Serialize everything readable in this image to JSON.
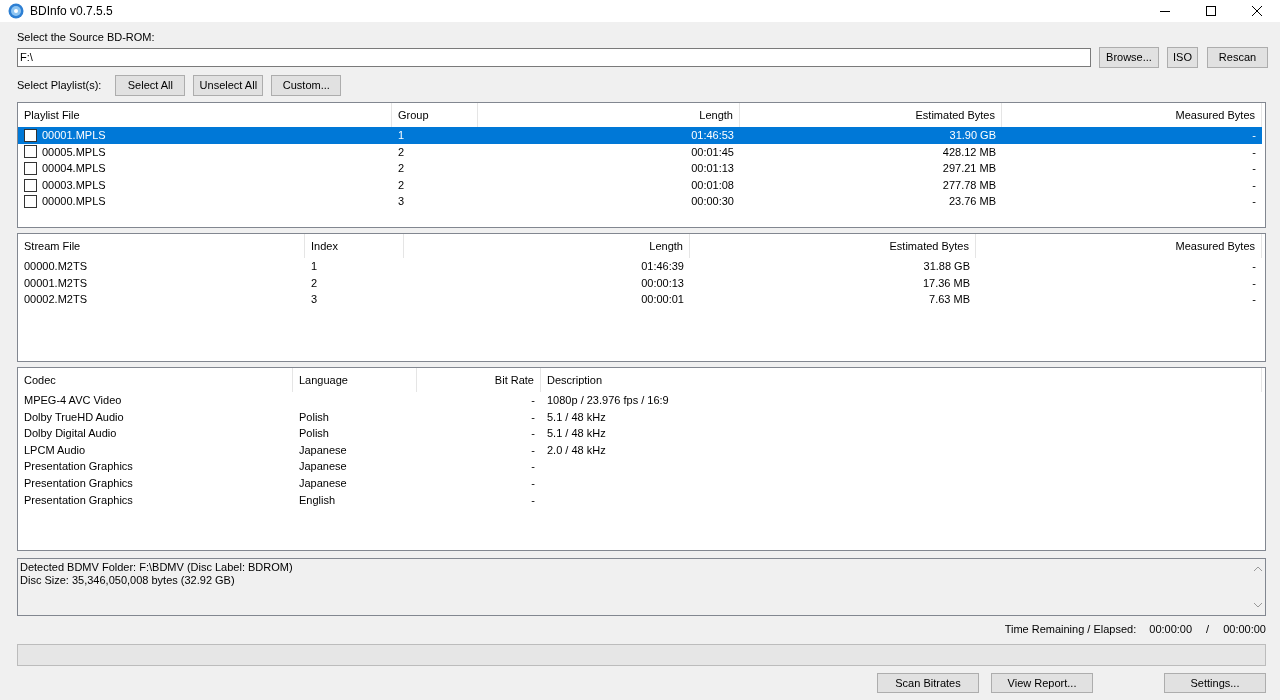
{
  "window": {
    "title": "BDInfo v0.7.5.5"
  },
  "source": {
    "label": "Select the Source BD-ROM:",
    "value": "F:\\",
    "buttons": [
      "Browse...",
      "ISO",
      "Rescan"
    ]
  },
  "playlist_select": {
    "label": "Select Playlist(s):",
    "buttons": [
      "Select All",
      "Unselect All",
      "Custom..."
    ]
  },
  "playlists": {
    "columns": [
      "Playlist File",
      "Group",
      "Length",
      "Estimated Bytes",
      "Measured Bytes"
    ],
    "rows": [
      {
        "checked": false,
        "selected": true,
        "cells": [
          "00001.MPLS",
          "1",
          "01:46:53",
          "31.90 GB",
          "-"
        ]
      },
      {
        "checked": false,
        "selected": false,
        "cells": [
          "00005.MPLS",
          "2",
          "00:01:45",
          "428.12 MB",
          "-"
        ]
      },
      {
        "checked": false,
        "selected": false,
        "cells": [
          "00004.MPLS",
          "2",
          "00:01:13",
          "297.21 MB",
          "-"
        ]
      },
      {
        "checked": false,
        "selected": false,
        "cells": [
          "00003.MPLS",
          "2",
          "00:01:08",
          "277.78 MB",
          "-"
        ]
      },
      {
        "checked": false,
        "selected": false,
        "cells": [
          "00000.MPLS",
          "3",
          "00:00:30",
          "23.76 MB",
          "-"
        ]
      }
    ]
  },
  "streams": {
    "columns": [
      "Stream File",
      "Index",
      "Length",
      "Estimated Bytes",
      "Measured Bytes"
    ],
    "rows": [
      [
        "00000.M2TS",
        "1",
        "01:46:39",
        "31.88 GB",
        "-"
      ],
      [
        "00001.M2TS",
        "2",
        "00:00:13",
        "17.36 MB",
        "-"
      ],
      [
        "00002.M2TS",
        "3",
        "00:00:01",
        "7.63 MB",
        "-"
      ]
    ]
  },
  "codecs": {
    "columns": [
      "Codec",
      "Language",
      "Bit Rate",
      "Description"
    ],
    "rows": [
      [
        "MPEG-4 AVC Video",
        "",
        "-",
        "1080p / 23.976 fps / 16:9"
      ],
      [
        "Dolby TrueHD Audio",
        "Polish",
        "-",
        "5.1 / 48 kHz"
      ],
      [
        "Dolby Digital Audio",
        "Polish",
        "-",
        "5.1 / 48 kHz"
      ],
      [
        "LPCM Audio",
        "Japanese",
        "-",
        "2.0 / 48 kHz"
      ],
      [
        "Presentation Graphics",
        "Japanese",
        "-",
        ""
      ],
      [
        "Presentation Graphics",
        "Japanese",
        "-",
        ""
      ],
      [
        "Presentation Graphics",
        "English",
        "-",
        ""
      ]
    ]
  },
  "log": [
    "Detected BDMV Folder: F:\\BDMV (Disc Label: BDROM)",
    "Disc Size: 35,346,050,008 bytes (32.92 GB)"
  ],
  "time": {
    "label": "Time Remaining / Elapsed:",
    "remaining": "00:00:00",
    "separator": "/",
    "elapsed": "00:00:00"
  },
  "progress": {
    "level": 0
  },
  "buttons": [
    "Scan Bitrates",
    "View Report...",
    "Settings..."
  ]
}
